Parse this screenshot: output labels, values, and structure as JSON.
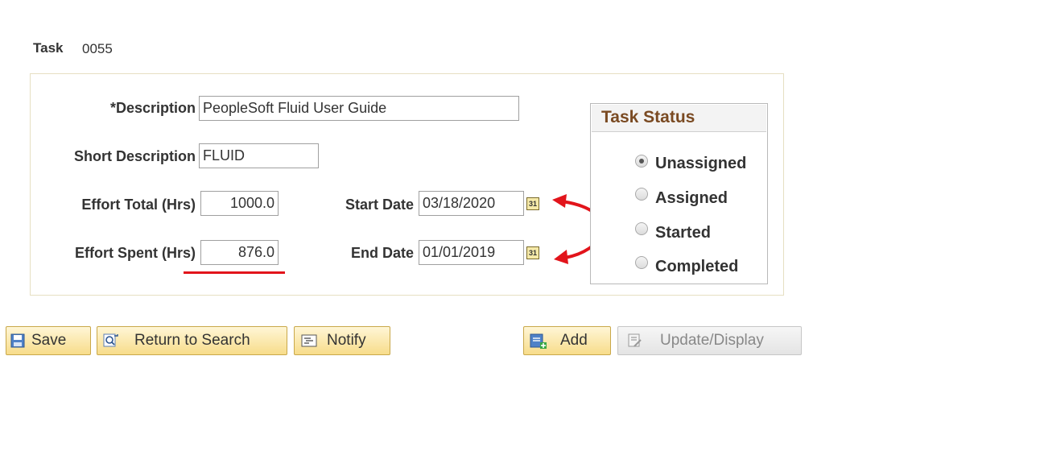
{
  "task": {
    "label": "Task",
    "value": "0055"
  },
  "form": {
    "description": {
      "label": "*Description",
      "value": "PeopleSoft Fluid User Guide"
    },
    "short_description": {
      "label": "Short Description",
      "value": "FLUID"
    },
    "effort_total": {
      "label": "Effort Total (Hrs)",
      "value": "1000.0"
    },
    "effort_spent": {
      "label": "Effort Spent (Hrs)",
      "value": "876.0"
    },
    "start_date": {
      "label": "Start Date",
      "value": "03/18/2020"
    },
    "end_date": {
      "label": "End Date",
      "value": "01/01/2019"
    }
  },
  "task_status": {
    "title": "Task Status",
    "options": [
      {
        "label": "Unassigned",
        "selected": true
      },
      {
        "label": "Assigned",
        "selected": false
      },
      {
        "label": "Started",
        "selected": false
      },
      {
        "label": "Completed",
        "selected": false
      }
    ]
  },
  "toolbar": {
    "save": "Save",
    "return_to_search": "Return to Search",
    "notify": "Notify",
    "add": "Add",
    "update_display": "Update/Display"
  },
  "icons": {
    "calendar": "calendar-icon",
    "save": "save-icon",
    "search": "search-icon",
    "notify": "notify-icon",
    "add": "add-icon",
    "update": "update-icon"
  },
  "annotation_color": "#e2141b"
}
